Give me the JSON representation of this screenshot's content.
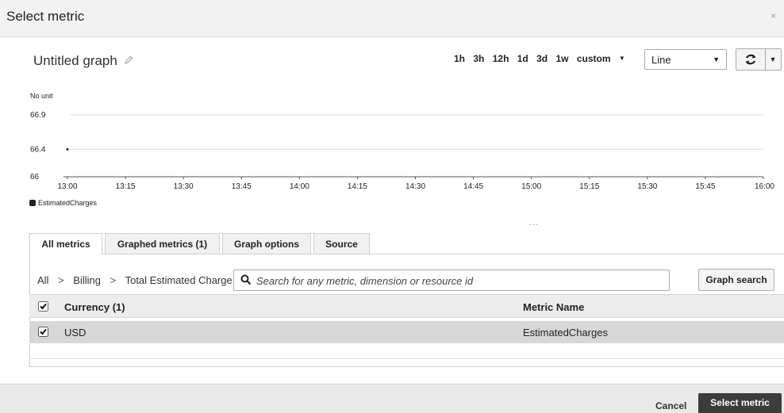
{
  "modal": {
    "title": "Select metric",
    "close_glyph": "×"
  },
  "graph": {
    "title": "Untitled graph",
    "time_ranges": [
      "1h",
      "3h",
      "12h",
      "1d",
      "3d",
      "1w"
    ],
    "custom_label": "custom",
    "view_type": "Line"
  },
  "chart_data": {
    "type": "line",
    "unit_label": "No unit",
    "y_ticks": [
      66.9,
      66.4,
      66
    ],
    "x_ticks": [
      "13:00",
      "13:15",
      "13:30",
      "13:45",
      "14:00",
      "14:15",
      "14:30",
      "14:45",
      "15:00",
      "15:15",
      "15:30",
      "15:45",
      "16:00"
    ],
    "series": [
      {
        "name": "EstimatedCharges",
        "points": [
          {
            "x": "13:00",
            "y": 66.4
          }
        ]
      }
    ],
    "ylim": [
      66,
      66.9
    ],
    "grid": true,
    "legend": "bottom-left"
  },
  "tabs": [
    {
      "label": "All metrics",
      "active": true
    },
    {
      "label": "Graphed metrics (1)",
      "active": false
    },
    {
      "label": "Graph options",
      "active": false
    },
    {
      "label": "Source",
      "active": false
    }
  ],
  "browser": {
    "breadcrumb": [
      "All",
      "Billing",
      "Total Estimated Charge"
    ],
    "breadcrumb_sep": ">",
    "search_placeholder": "Search for any metric, dimension or resource id",
    "graph_search_label": "Graph search"
  },
  "table": {
    "headers": {
      "dimension": "Currency (1)",
      "metric": "Metric Name"
    },
    "rows": [
      {
        "dimension": "USD",
        "metric": "EstimatedCharges",
        "checked": true
      }
    ]
  },
  "footer": {
    "cancel_label": "Cancel",
    "submit_label": "Select metric"
  },
  "colors": {
    "primary_button": "#3c3c3c",
    "header_bg": "#f2f2f2",
    "selected_row": "#d7d7d7"
  }
}
